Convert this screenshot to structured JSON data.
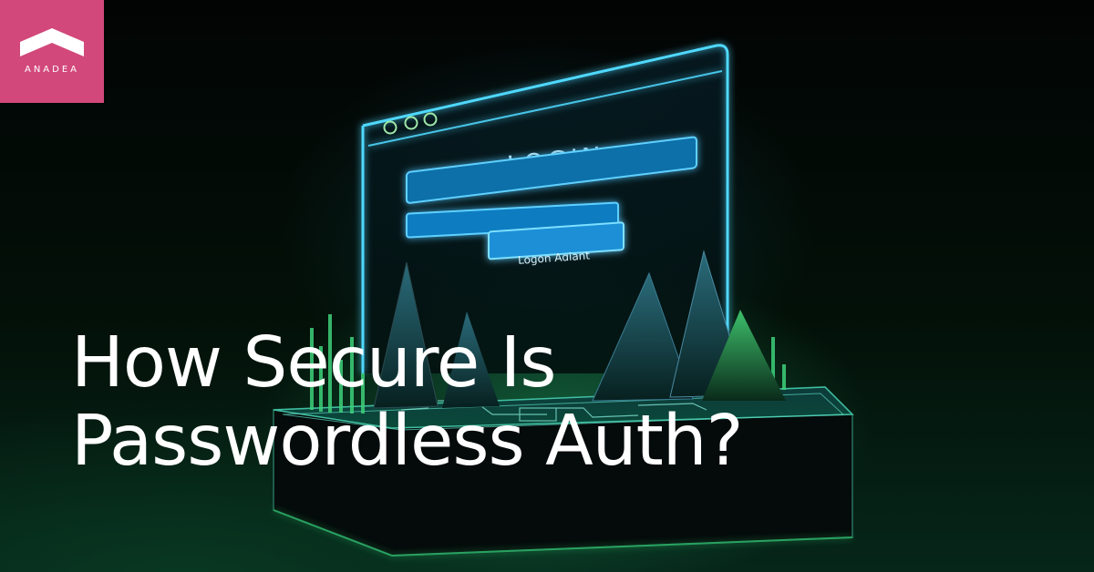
{
  "brand": {
    "name": "ANADEA",
    "color": "#d2487a"
  },
  "headline": {
    "line1": "How Secure Is",
    "line2": "Passwordless Auth?"
  },
  "illustration": {
    "login_title": "LOGIN",
    "button_label": "Loɡon Aɑiant",
    "accent_color": "#4fd8ff",
    "glow_color": "#2fbf6a"
  }
}
